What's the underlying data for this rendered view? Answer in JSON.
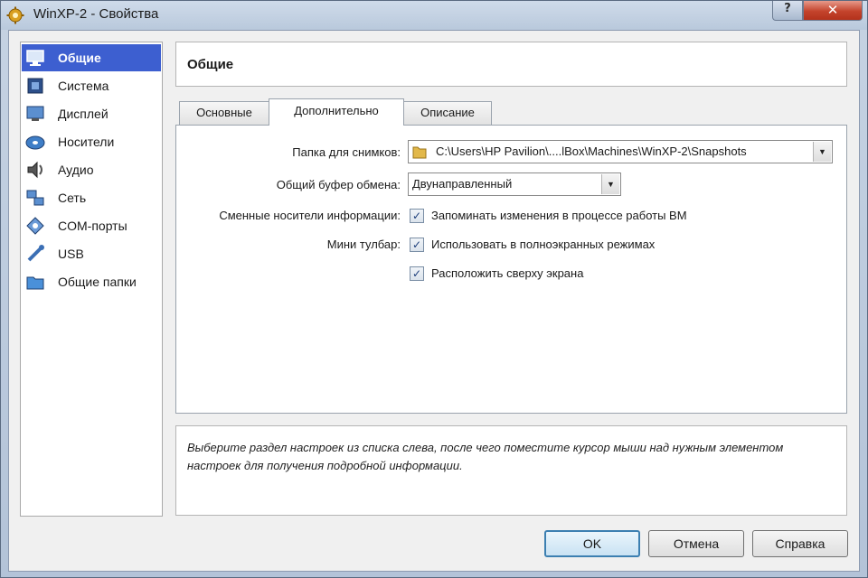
{
  "window": {
    "title": "WinXP-2 - Свойства",
    "help_label": "?",
    "close_label": "✕"
  },
  "sidebar": {
    "items": [
      {
        "label": "Общие",
        "icon": "general-monitor-icon",
        "selected": true
      },
      {
        "label": "Система",
        "icon": "system-chip-icon"
      },
      {
        "label": "Дисплей",
        "icon": "display-icon"
      },
      {
        "label": "Носители",
        "icon": "storage-disc-icon"
      },
      {
        "label": "Аудио",
        "icon": "audio-speaker-icon"
      },
      {
        "label": "Сеть",
        "icon": "network-icon"
      },
      {
        "label": "COM-порты",
        "icon": "com-port-icon"
      },
      {
        "label": "USB",
        "icon": "usb-icon"
      },
      {
        "label": "Общие папки",
        "icon": "shared-folder-icon"
      }
    ]
  },
  "header": {
    "title": "Общие"
  },
  "tabs": [
    {
      "label": "Основные"
    },
    {
      "label": "Дополнительно",
      "active": true
    },
    {
      "label": "Описание"
    }
  ],
  "advanced": {
    "snapshot_folder_label": "Папка для снимков:",
    "snapshot_folder_value": "C:\\Users\\HP Pavilion\\....lBox\\Machines\\WinXP-2\\Snapshots",
    "clipboard_label": "Общий буфер обмена:",
    "clipboard_value": "Двунаправленный",
    "removable_media_label": "Сменные носители информации:",
    "removable_media_checkbox": "Запоминать изменения в процессе работы ВМ",
    "mini_toolbar_label": "Мини тулбар:",
    "mini_toolbar_fullscreen": "Использовать в полноэкранных режимах",
    "mini_toolbar_top": "Расположить сверху экрана",
    "checked": [
      true,
      true,
      true
    ]
  },
  "info": {
    "text": "Выберите раздел настроек из списка слева, после чего поместите курсор мыши над нужным элементом настроек для получения подробной информации."
  },
  "buttons": {
    "ok": "OK",
    "cancel": "Отмена",
    "help": "Справка"
  }
}
